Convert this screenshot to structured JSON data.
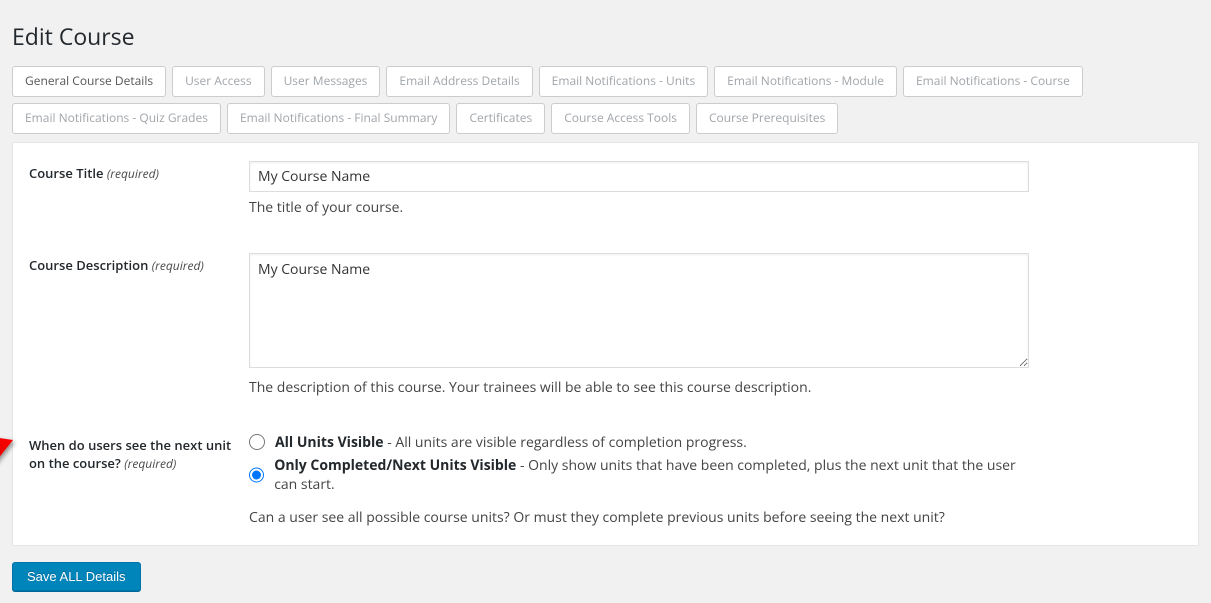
{
  "pageTitle": "Edit Course",
  "tabs": {
    "row1": [
      "General Course Details",
      "User Access",
      "User Messages",
      "Email Address Details",
      "Email Notifications - Units",
      "Email Notifications - Module",
      "Email Notifications - Course"
    ],
    "row2": [
      "Email Notifications - Quiz Grades",
      "Email Notifications - Final Summary",
      "Certificates",
      "Course Access Tools",
      "Course Prerequisites"
    ],
    "activeIndex": 0
  },
  "fields": {
    "courseTitle": {
      "label": "Course Title",
      "required": "(required)",
      "value": "My Course Name",
      "help": "The title of your course."
    },
    "courseDescription": {
      "label": "Course Description",
      "required": "(required)",
      "value": "My Course Name",
      "help": "The description of this course. Your trainees will be able to see this course description."
    },
    "unitVisibility": {
      "label": "When do users see the next unit on the course?",
      "required": "(required)",
      "options": [
        {
          "strong": "All Units Visible",
          "rest": " - All units are visible regardless of completion progress."
        },
        {
          "strong": "Only Completed/Next Units Visible",
          "rest": " - Only show units that have been completed, plus the next unit that the user can start."
        }
      ],
      "selectedIndex": 1,
      "help": "Can a user see all possible course units? Or must they complete previous units before seeing the next unit?"
    }
  },
  "saveButton": "Save ALL Details"
}
